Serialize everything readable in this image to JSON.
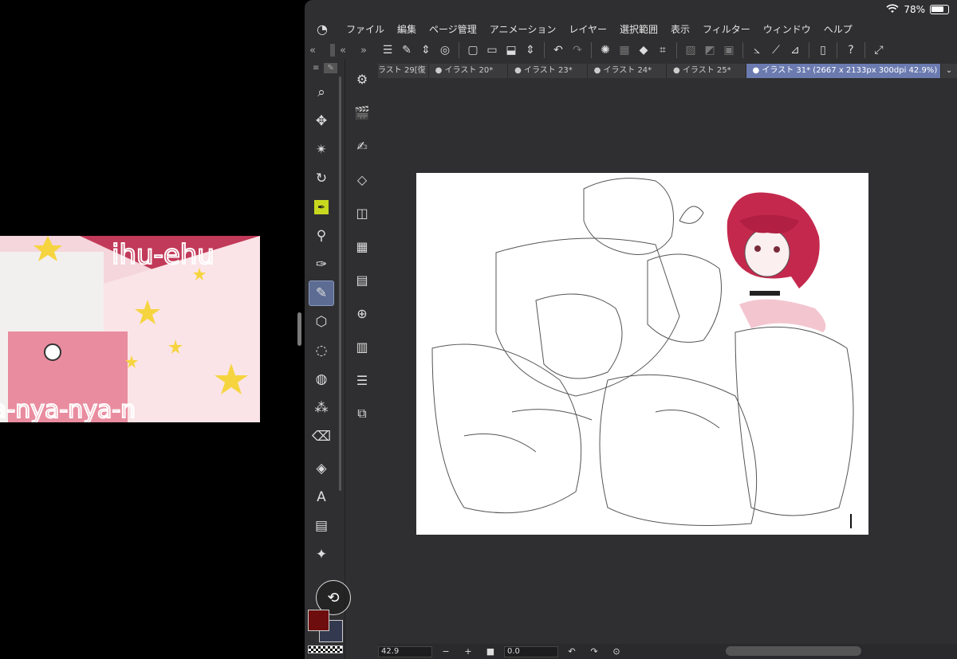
{
  "status_bar": {
    "battery_text": "78%",
    "wifi_icon": "wifi-icon",
    "battery_icon": "battery-icon"
  },
  "menu": [
    "ファイル",
    "編集",
    "ページ管理",
    "アニメーション",
    "レイヤー",
    "選択範囲",
    "表示",
    "フィルター",
    "ウィンドウ",
    "ヘルプ"
  ],
  "tabs": [
    {
      "label": "ラスト 29[復"
    },
    {
      "label": "● イラスト 20*"
    },
    {
      "label": "● イラスト 23*"
    },
    {
      "label": "● イラスト 24*"
    },
    {
      "label": "● イラスト 25*"
    },
    {
      "label": "● イラスト 31* (2667 x 2133px 300dpi 42.9%)"
    }
  ],
  "bottom_bar": {
    "zoom": "42.9",
    "minus": "−",
    "plus": "+",
    "rotation": "0.0"
  },
  "colors": {
    "main": "#6e0d0e",
    "sub": "#333a4f",
    "active_tab": "#6b7bb0",
    "tool_active": "#5c6c92"
  }
}
